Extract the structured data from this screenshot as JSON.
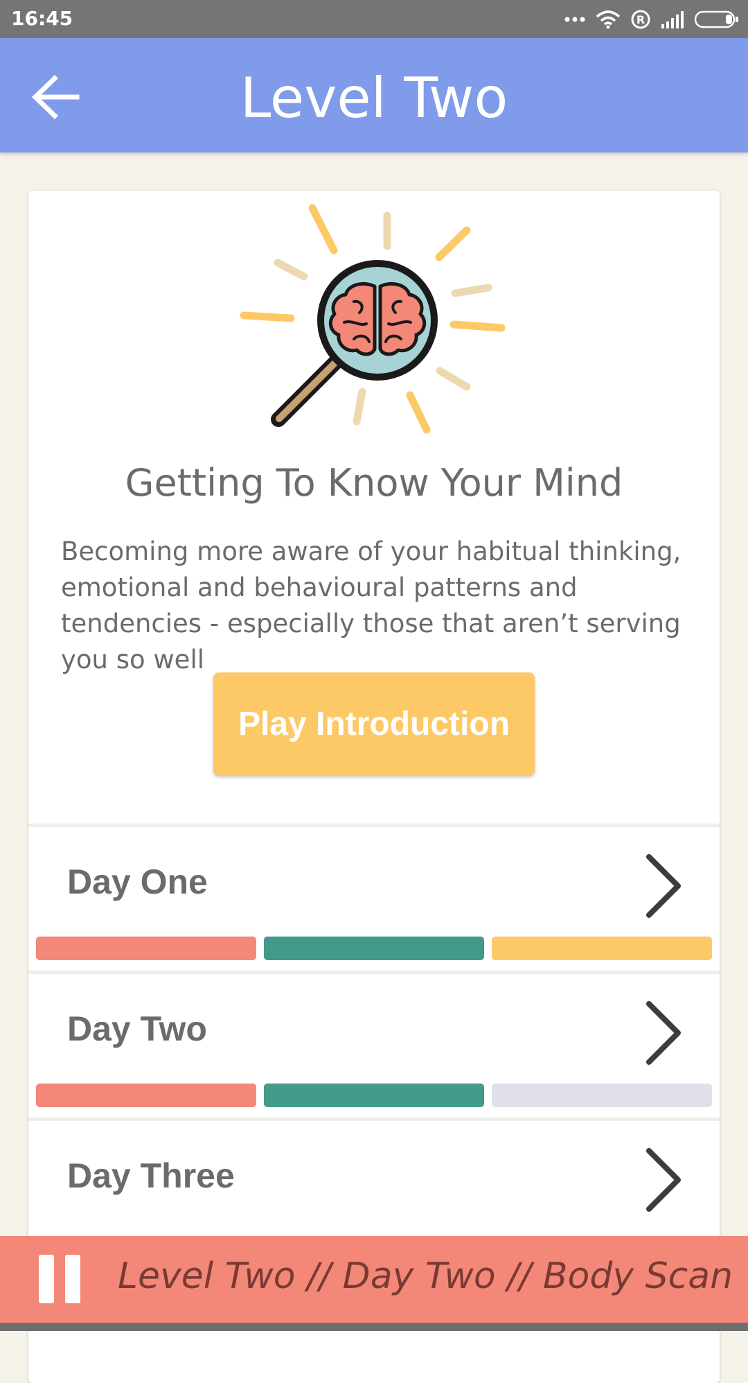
{
  "status_bar": {
    "time": "16:45",
    "icons": [
      "more-dots-icon",
      "wifi-icon",
      "registered-icon",
      "signal-icon",
      "battery-icon"
    ]
  },
  "app_bar": {
    "title": "Level Two",
    "back_icon": "back-arrow-icon"
  },
  "card": {
    "illustration": "brain-magnifier-icon",
    "heading": "Getting To Know Your Mind",
    "description": "Becoming more aware of your habitual thinking, emotional and behavioural patterns and tendencies - especially those that aren’t serving you so well",
    "play_label": "Play Introduction"
  },
  "days": [
    {
      "label": "Day One",
      "progress": [
        "#f48878",
        "#439a8b",
        "#fdc966"
      ]
    },
    {
      "label": "Day Two",
      "progress": [
        "#f48878",
        "#439a8b",
        "#dfe0ea"
      ]
    },
    {
      "label": "Day Three"
    }
  ],
  "player": {
    "now_playing": "Level Two // Day Two // Body Scan",
    "state": "playing"
  },
  "colors": {
    "app_bar": "#7f9bea",
    "accent_yellow": "#fdc966",
    "coral": "#f48878",
    "teal": "#439a8b",
    "inactive": "#dfe0ea",
    "background": "#f5f3e9"
  }
}
